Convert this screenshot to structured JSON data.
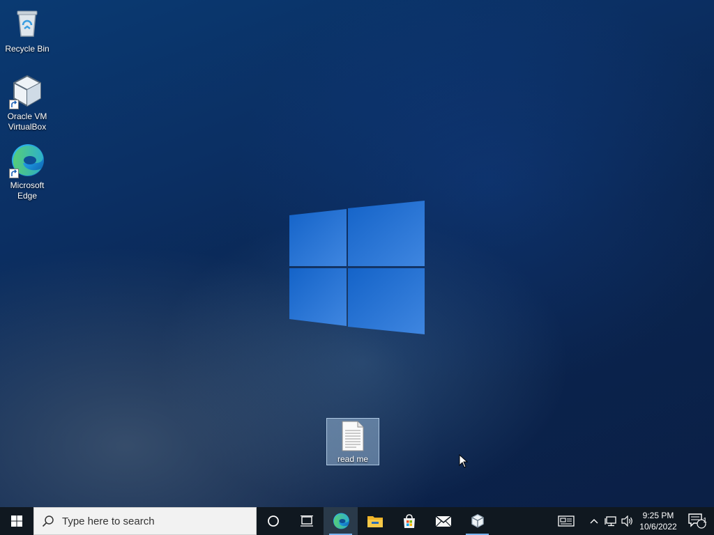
{
  "desktop": {
    "icons": [
      {
        "label": "Recycle Bin",
        "icon": "recycle-bin-icon"
      },
      {
        "label": "Oracle VM\nVirtualBox",
        "icon": "virtualbox-icon"
      },
      {
        "label": "Microsoft\nEdge",
        "icon": "edge-icon"
      }
    ],
    "file": {
      "label": "read me",
      "icon": "text-document-icon"
    }
  },
  "taskbar": {
    "search_placeholder": "Type here to search",
    "apps": [
      "edge-icon",
      "file-explorer-icon",
      "store-icon",
      "mail-icon",
      "virtualbox-icon"
    ],
    "clock_time": "9:25 PM",
    "clock_date": "10/6/2022",
    "notification_count": "1"
  },
  "colors": {
    "taskbar": "#101820",
    "accent": "#3a8ee6",
    "logo_blue": "#1f6fd1"
  }
}
